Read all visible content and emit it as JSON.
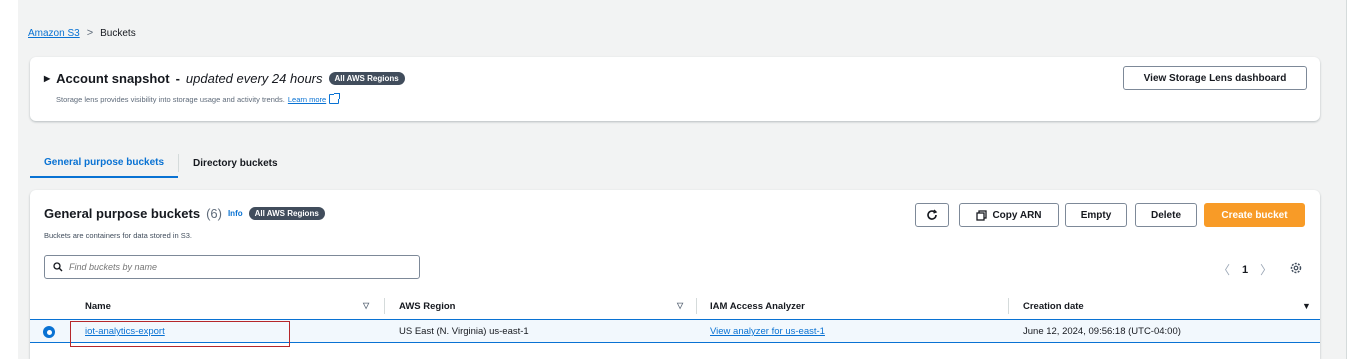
{
  "breadcrumb": {
    "root": "Amazon S3",
    "separator": ">",
    "current": "Buckets"
  },
  "snapshot": {
    "title": "Account snapshot",
    "title_dash": "-",
    "subtitle": "updated every 24 hours",
    "badge": "All AWS Regions",
    "description": "Storage lens provides visibility into storage usage and activity trends.",
    "learn_more": "Learn more",
    "dashboard_button": "View Storage Lens dashboard"
  },
  "tabs": [
    {
      "label": "General purpose buckets",
      "active": true
    },
    {
      "label": "Directory buckets",
      "active": false
    }
  ],
  "buckets": {
    "title": "General purpose buckets",
    "count": "(6)",
    "info": "Info",
    "badge": "All AWS Regions",
    "description": "Buckets are containers for data stored in S3.",
    "search_placeholder": "Find buckets by name",
    "toolbar": {
      "copy_arn": "Copy ARN",
      "empty": "Empty",
      "delete": "Delete",
      "create": "Create bucket"
    },
    "pager": {
      "prev": "〈",
      "page": "1",
      "next": "〉"
    },
    "columns": [
      "Name",
      "AWS Region",
      "IAM Access Analyzer",
      "Creation date"
    ],
    "rows": [
      {
        "name": "iot-analytics-export",
        "region": "US East (N. Virginia) us-east-1",
        "analyzer": "View analyzer for us-east-1",
        "created": "June 12, 2024, 09:56:18 (UTC-04:00)"
      }
    ]
  },
  "colors": {
    "link": "#0972d3",
    "primary": "#f89b27",
    "badge": "#414d5c",
    "highlight": "#b5272a"
  }
}
